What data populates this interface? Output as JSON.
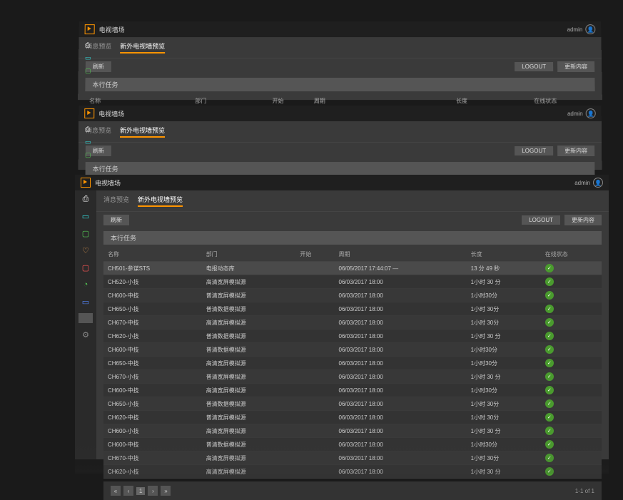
{
  "app_title": "电视墙场",
  "user": "admin",
  "tabs": [
    "消息预览",
    "新外电视墙预览"
  ],
  "toolbar": {
    "refresh": "刷新",
    "logout": "LOGOUT",
    "btn2": "更新内容"
  },
  "section": "本行任务",
  "columns": {
    "c1": "名称",
    "c2": "部门",
    "c3": "开始",
    "c4": "周期",
    "c5": "长度",
    "c6": "在线状态"
  },
  "rows": [
    {
      "name": "CH501-参谋STS",
      "dept": "电报动态库",
      "start": "",
      "period": "06/05/2017 17:44:07 —",
      "dur": "13 分 49 秒"
    },
    {
      "name": "CH520-小技",
      "dept": "高清宽屏模拟源",
      "start": "",
      "period": "06/03/2017 18:00",
      "dur": "1小时 30 分"
    },
    {
      "name": "CH600-中技",
      "dept": "普清宽屏模拟源",
      "start": "",
      "period": "06/03/2017 18:00",
      "dur": "1小时30分"
    },
    {
      "name": "CH650-小技",
      "dept": "普清数据模拟源",
      "start": "",
      "period": "06/03/2017 18:00",
      "dur": "1小时 30分"
    },
    {
      "name": "CH670-中技",
      "dept": "高清宽屏模拟源",
      "start": "",
      "period": "06/03/2017 18:00",
      "dur": "1小时 30分"
    },
    {
      "name": "CH620-小技",
      "dept": "普清数据模拟源",
      "start": "",
      "period": "06/03/2017 18:00",
      "dur": "1小时 30 分"
    },
    {
      "name": "CH600-中技",
      "dept": "普清数据模拟源",
      "start": "",
      "period": "06/03/2017 18:00",
      "dur": "1小时30分"
    },
    {
      "name": "CH650-中技",
      "dept": "高清宽屏模拟源",
      "start": "",
      "period": "06/03/2017 18:00",
      "dur": "1小时30分"
    },
    {
      "name": "CH670-小技",
      "dept": "普清宽屏模拟源",
      "start": "",
      "period": "06/03/2017 18:00",
      "dur": "1小时 30 分"
    },
    {
      "name": "CH600-中技",
      "dept": "高清宽屏模拟源",
      "start": "",
      "period": "06/03/2017 18:00",
      "dur": "1小时30分"
    },
    {
      "name": "CH650-小技",
      "dept": "普清数据模拟源",
      "start": "",
      "period": "06/03/2017 18:00",
      "dur": "1小时 30分"
    },
    {
      "name": "CH620-中技",
      "dept": "普清宽屏模拟源",
      "start": "",
      "period": "06/03/2017 18:00",
      "dur": "1小时 30分"
    },
    {
      "name": "CH600-小技",
      "dept": "高清宽屏模拟源",
      "start": "",
      "period": "06/03/2017 18:00",
      "dur": "1小时 30 分"
    },
    {
      "name": "CH600-中技",
      "dept": "普清数据模拟源",
      "start": "",
      "period": "06/03/2017 18:00",
      "dur": "1小时30分"
    },
    {
      "name": "CH670-中技",
      "dept": "高清宽屏模拟源",
      "start": "",
      "period": "06/03/2017 18:00",
      "dur": "1小时 30分"
    },
    {
      "name": "CH620-小技",
      "dept": "高清宽屏模拟源",
      "start": "",
      "period": "06/03/2017 18:00",
      "dur": "1小时 30 分"
    }
  ],
  "pager": {
    "page": "1",
    "info": "1-1 of 1"
  },
  "icons": [
    "print",
    "screen",
    "monitor",
    "heart",
    "square",
    "chart",
    "folder",
    "border",
    "gear"
  ]
}
